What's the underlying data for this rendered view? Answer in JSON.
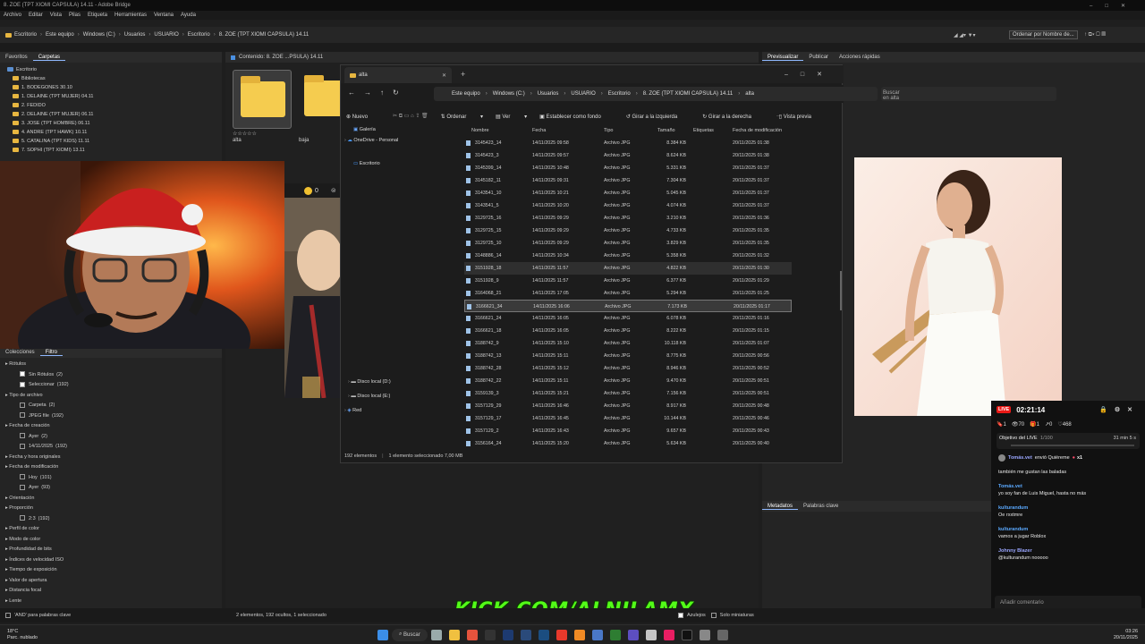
{
  "bridge": {
    "title": "8. ZOE (TPT XIOMI CAPSULA) 14.11 - Adobe Bridge",
    "menu": [
      "Archivo",
      "Editar",
      "Vista",
      "Pilas",
      "Etiqueta",
      "Herramientas",
      "Ventana",
      "Ayuda"
    ],
    "path": [
      "Escritorio",
      "Este equipo",
      "Windows (C:)",
      "Usuarios",
      "USUARIO",
      "Escritorio",
      "8. ZOE (TPT XIOMI CAPSULA) 14.11"
    ],
    "sort_label": "Ordenar por Nombre de...",
    "left_tabs": [
      "Favoritos",
      "Carpetas"
    ],
    "folders": [
      "Escritorio",
      "Bibliotecas",
      "1. BODEGONES 30.10",
      "1. DELAINE (TPT MUJER) 04.11",
      "2. FEDIDO",
      "2. DELAINE (TPT MUJER) 06.11",
      "3. JOSE (TPT HOMBRE) 06.11",
      "4. ANDRE (TPT HAWK) 10.11",
      "5. CATALINA (TPT KIDS) 11.11",
      "7. SOPHI (TPT XIOMI) 13.11"
    ],
    "filter_tabs": [
      "Colecciones",
      "Filtro"
    ],
    "filters": [
      {
        "label": "Rótulos",
        "level": 0
      },
      {
        "label": "Sin Rótulos",
        "count": "(2)",
        "level": 1,
        "check": true
      },
      {
        "label": "Seleccionar",
        "count": "(192)",
        "level": 1,
        "check": true
      },
      {
        "label": "Tipo de archivo",
        "level": 0
      },
      {
        "label": "Carpeta",
        "count": "(2)",
        "level": 1,
        "check": false
      },
      {
        "label": "JPEG file",
        "count": "(192)",
        "level": 1,
        "check": false
      },
      {
        "label": "Fecha de creación",
        "level": 0
      },
      {
        "label": "Ayer",
        "count": "(2)",
        "level": 1,
        "check": false
      },
      {
        "label": "14/11/2025",
        "count": "(192)",
        "level": 1,
        "check": false
      },
      {
        "label": "Fecha y hora originales",
        "level": 0
      },
      {
        "label": "Fecha de modificación",
        "level": 0
      },
      {
        "label": "Hoy",
        "count": "(101)",
        "level": 1,
        "check": false
      },
      {
        "label": "Ayer",
        "count": "(93)",
        "level": 1,
        "check": false
      },
      {
        "label": "Orientación",
        "level": 0
      },
      {
        "label": "Proporción",
        "level": 0
      },
      {
        "label": "2:3",
        "count": "(192)",
        "level": 1,
        "check": false
      },
      {
        "label": "Perfil de color",
        "level": 0
      },
      {
        "label": "Modo de color",
        "level": 0
      },
      {
        "label": "Profundidad de bits",
        "level": 0
      },
      {
        "label": "Índices de velocidad ISO",
        "level": 0
      },
      {
        "label": "Tiempo de exposición",
        "level": 0
      },
      {
        "label": "Valor de apertura",
        "level": 0
      },
      {
        "label": "Distancia focal",
        "level": 0
      },
      {
        "label": "Lente",
        "level": 0
      }
    ],
    "content_tab": "Contenido: 8. ZOE ...PSULA) 14.11",
    "thumbs": [
      {
        "label": "alta"
      },
      {
        "label": "baja"
      }
    ],
    "right_tabs": [
      "Previsualizar",
      "Publicar",
      "Acciones rápidas"
    ],
    "meta_tabs": [
      "Metadatos",
      "Palabras clave"
    ],
    "status_left": "'AND' para palabras clave",
    "status_mid": "2 elementos, 192 ocultos, 1 seleccionado",
    "status_right": [
      "Azulejos",
      "Solo miniaturas"
    ]
  },
  "explorer": {
    "tab_title": "alta",
    "breadcrumb": [
      "Este equipo",
      "Windows (C:)",
      "Usuarios",
      "USUARIO",
      "Escritorio",
      "8. ZOE (TPT XIOMI CAPSULA) 14.11",
      "alta"
    ],
    "search_placeholder": "Buscar en alta",
    "commands": {
      "new": "Nuevo",
      "sort": "Ordenar",
      "view": "Ver",
      "wallpaper": "Establecer como fondo",
      "rotate_left": "Girar a la izquierda",
      "rotate_right": "Girar a la derecha",
      "preview": "Vista previa"
    },
    "nav": {
      "gallery": "Galería",
      "onedrive": "OneDrive - Personal",
      "desktop": "Escritorio",
      "disk_d": "Disco local (D:)",
      "disk_e": "Disco local (E:)",
      "network": "Red"
    },
    "columns": [
      "Nombre",
      "Fecha",
      "Tipo",
      "Tamaño",
      "Etiquetas",
      "Fecha de modificación"
    ],
    "files": [
      {
        "name": "3145423_14",
        "date": "14/11/2025 09:58",
        "type": "Archivo JPG",
        "size": "8.384 KB",
        "mod": "20/11/2025 01:38"
      },
      {
        "name": "3145423_3",
        "date": "14/11/2025 09:57",
        "type": "Archivo JPG",
        "size": "8.624 KB",
        "mod": "20/11/2025 01:38"
      },
      {
        "name": "3145399_14",
        "date": "14/11/2025 10:48",
        "type": "Archivo JPG",
        "size": "5.331 KB",
        "mod": "20/11/2025 01:37"
      },
      {
        "name": "3145182_11",
        "date": "14/11/2025 09:31",
        "type": "Archivo JPG",
        "size": "7.304 KB",
        "mod": "20/11/2025 01:37"
      },
      {
        "name": "3143541_10",
        "date": "14/11/2025 10:21",
        "type": "Archivo JPG",
        "size": "5.045 KB",
        "mod": "20/11/2025 01:37"
      },
      {
        "name": "3143541_5",
        "date": "14/11/2025 10:20",
        "type": "Archivo JPG",
        "size": "4.074 KB",
        "mod": "20/11/2025 01:37"
      },
      {
        "name": "3129725_16",
        "date": "14/11/2025 09:29",
        "type": "Archivo JPG",
        "size": "3.210 KB",
        "mod": "20/11/2025 01:36"
      },
      {
        "name": "3129725_15",
        "date": "14/11/2025 09:29",
        "type": "Archivo JPG",
        "size": "4.733 KB",
        "mod": "20/11/2025 01:35"
      },
      {
        "name": "3129725_10",
        "date": "14/11/2025 09:29",
        "type": "Archivo JPG",
        "size": "3.829 KB",
        "mod": "20/11/2025 01:35"
      },
      {
        "name": "3148886_14",
        "date": "14/11/2025 10:34",
        "type": "Archivo JPG",
        "size": "5.358 KB",
        "mod": "20/11/2025 01:32"
      },
      {
        "name": "3151928_18",
        "date": "14/11/2025 11:57",
        "type": "Archivo JPG",
        "size": "4.822 KB",
        "mod": "20/11/2025 01:30"
      },
      {
        "name": "3151928_9",
        "date": "14/11/2025 11:57",
        "type": "Archivo JPG",
        "size": "6.377 KB",
        "mod": "20/11/2025 01:29"
      },
      {
        "name": "3164068_21",
        "date": "14/11/2025 17:05",
        "type": "Archivo JPG",
        "size": "5.294 KB",
        "mod": "20/11/2025 01:25"
      },
      {
        "name": "3166621_34",
        "date": "14/11/2025 16:06",
        "type": "Archivo JPG",
        "size": "7.173 KB",
        "mod": "20/11/2025 01:17"
      },
      {
        "name": "3166621_24",
        "date": "14/11/2025 16:05",
        "type": "Archivo JPG",
        "size": "6.078 KB",
        "mod": "20/11/2025 01:16"
      },
      {
        "name": "3166621_18",
        "date": "14/11/2025 16:05",
        "type": "Archivo JPG",
        "size": "8.222 KB",
        "mod": "20/11/2025 01:15"
      },
      {
        "name": "3188742_9",
        "date": "14/11/2025 15:10",
        "type": "Archivo JPG",
        "size": "10.118 KB",
        "mod": "20/11/2025 01:07"
      },
      {
        "name": "3188742_13",
        "date": "14/11/2025 15:11",
        "type": "Archivo JPG",
        "size": "8.775 KB",
        "mod": "20/11/2025 00:56"
      },
      {
        "name": "3188742_28",
        "date": "14/11/2025 15:12",
        "type": "Archivo JPG",
        "size": "8.946 KB",
        "mod": "20/11/2025 00:52"
      },
      {
        "name": "3188742_22",
        "date": "14/11/2025 15:11",
        "type": "Archivo JPG",
        "size": "9.470 KB",
        "mod": "20/11/2025 00:51"
      },
      {
        "name": "3159139_3",
        "date": "14/11/2025 15:21",
        "type": "Archivo JPG",
        "size": "7.156 KB",
        "mod": "20/11/2025 00:51"
      },
      {
        "name": "3157129_29",
        "date": "14/11/2025 16:46",
        "type": "Archivo JPG",
        "size": "8.917 KB",
        "mod": "20/11/2025 00:48"
      },
      {
        "name": "3157129_17",
        "date": "14/11/2025 16:45",
        "type": "Archivo JPG",
        "size": "10.144 KB",
        "mod": "20/11/2025 00:46"
      },
      {
        "name": "3157129_2",
        "date": "14/11/2025 16:43",
        "type": "Archivo JPG",
        "size": "9.657 KB",
        "mod": "20/11/2025 00:43"
      },
      {
        "name": "3156164_24",
        "date": "14/11/2025 15:20",
        "type": "Archivo JPG",
        "size": "5.634 KB",
        "mod": "20/11/2025 00:40"
      }
    ],
    "selected_index": 13,
    "hover_index": 10,
    "status": "192 elementos",
    "status_sel": "1 elemento seleccionado 7,00 MB"
  },
  "chat": {
    "live": "LIVE",
    "time": "02:21:14",
    "stats": [
      "1",
      "70",
      "1",
      "0",
      "468"
    ],
    "goal": "Objetivo del LIVE",
    "goal_count": "1/100",
    "goal_time": "31 min 5 s",
    "gift_user": "Tomás.vet",
    "gift_text": "envió Quiéreme",
    "gift_mult": "x1",
    "msgs": [
      {
        "user": "",
        "text": "también me gustan las baladas"
      },
      {
        "user": "Tomás.vet",
        "text": "yo soy fan de Luis Miguel, hasta no más"
      },
      {
        "user": "kulturandum",
        "text": "Oe rxxtmre"
      },
      {
        "user": "kulturandum",
        "text": "vamos a jugar Roblox"
      },
      {
        "user": "Johnny Blazer",
        "text": "@kulturandum nooooo"
      }
    ],
    "input_placeholder": "Añadir comentario"
  },
  "overlay": {
    "kick": "KICK.COM/ALNILAMX"
  },
  "taskbar": {
    "weather_temp": "18°C",
    "weather_desc": "Parc. nublado",
    "search": "Buscar",
    "time": "03:26",
    "date": "20/11/2025"
  },
  "tv_counter": "0"
}
